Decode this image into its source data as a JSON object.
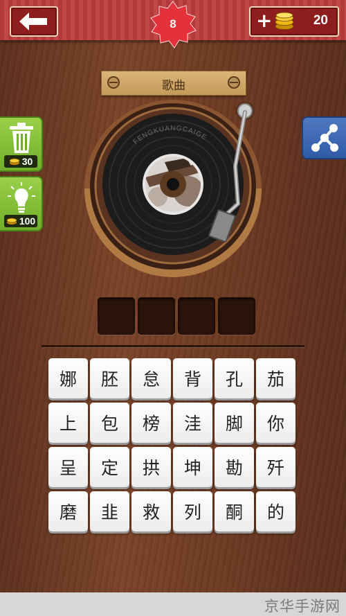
{
  "header": {
    "level": "8",
    "coins": "20",
    "plus_symbol": "+"
  },
  "category": {
    "label": "歌曲"
  },
  "record": {
    "brand_text": "FENGKUANGCAIGE"
  },
  "sidebar": {
    "delete_price": "30",
    "hint_price": "100"
  },
  "answer": {
    "slots": 4
  },
  "letters": [
    "娜",
    "胚",
    "怠",
    "背",
    "孔",
    "茄",
    "上",
    "包",
    "榜",
    "洼",
    "脚",
    "你",
    "呈",
    "定",
    "拱",
    "坤",
    "勘",
    "歼",
    "磨",
    "韭",
    "救",
    "列",
    "酮",
    "的"
  ],
  "footer": {
    "watermark": "京华手游网"
  },
  "colors": {
    "header_red": "#b23a3a",
    "button_green": "#7dbd33",
    "share_blue": "#3b64ae",
    "badge_red": "#e3323c"
  }
}
